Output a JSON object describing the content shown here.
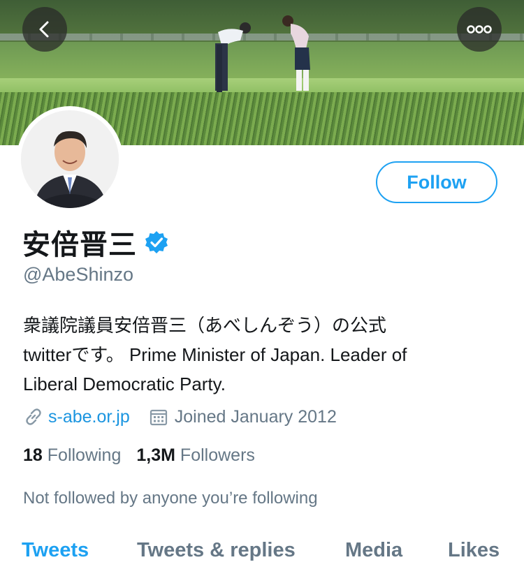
{
  "header": {
    "back_icon": "chevron-left-icon",
    "more_icon": "more-horizontal-icon"
  },
  "profile": {
    "name": "安倍晋三",
    "verified": true,
    "handle": "@AbeShinzo",
    "follow_label": "Follow",
    "bio_line1": "衆議院議員安倍晋三（あべしんぞう）の公式",
    "bio_line2": "twitterです。 Prime Minister of Japan. Leader of",
    "bio_line3": "Liberal Democratic Party.",
    "website": "s-abe.or.jp",
    "joined": "Joined January 2012",
    "following_count": "18",
    "following_label": "Following",
    "followers_count": "1,3M",
    "followers_label": "Followers",
    "not_followed_text": "Not followed by anyone you’re following"
  },
  "tabs": [
    {
      "label": "Tweets",
      "active": true
    },
    {
      "label": "Tweets & replies",
      "active": false
    },
    {
      "label": "Media",
      "active": false
    },
    {
      "label": "Likes",
      "active": false
    }
  ],
  "colors": {
    "accent": "#1da1f2",
    "secondary_text": "#657786",
    "primary_text": "#14171a"
  }
}
